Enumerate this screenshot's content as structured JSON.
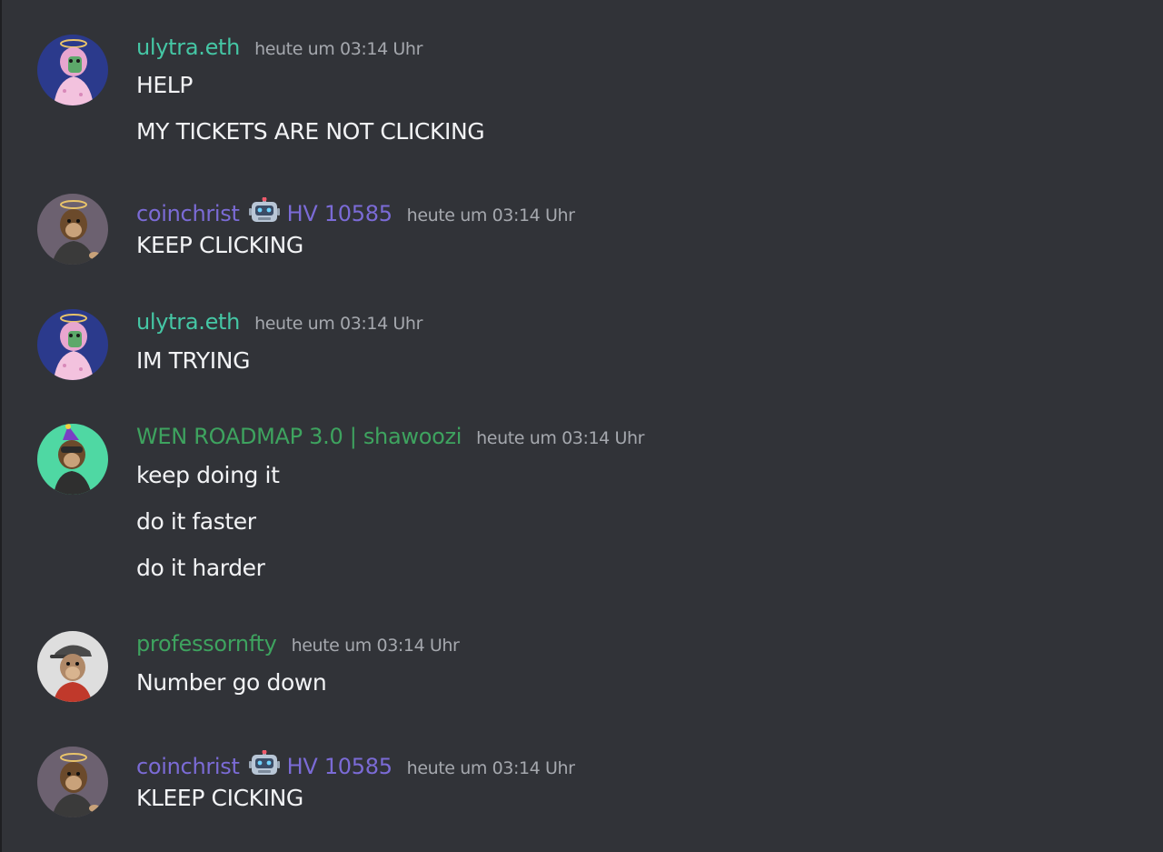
{
  "colors": {
    "background": "#313338",
    "timestamp": "#a5a8ae",
    "text": "#f2f3f5",
    "teal_name": "#45c7a5",
    "purple_name": "#7b6bd6",
    "green_name": "#3ea35f"
  },
  "messages": [
    {
      "author": "ulytra.eth",
      "author_color": "#45c7a5",
      "avatar_icon": "pink-ape-halo-avatar",
      "timestamp": "heute um 03:14 Uhr",
      "lines": [
        "HELP",
        "MY TICKETS ARE NOT CLICKING"
      ]
    },
    {
      "author": "coinchrist",
      "author_color": "#7b6bd6",
      "bot_icon": "robot-emoji-icon",
      "tag": "HV 10585",
      "avatar_icon": "brown-ape-halo-avatar",
      "timestamp": "heute um 03:14 Uhr",
      "lines": [
        "KEEP CLICKING"
      ]
    },
    {
      "author": "ulytra.eth",
      "author_color": "#45c7a5",
      "avatar_icon": "pink-ape-halo-avatar",
      "timestamp": "heute um 03:14 Uhr",
      "lines": [
        "IM TRYING"
      ]
    },
    {
      "author": "WEN ROADMAP 3.0 | shawoozi",
      "author_color": "#3ea35f",
      "avatar_icon": "party-hat-ape-avatar",
      "timestamp": "heute um 03:14 Uhr",
      "lines": [
        "keep doing it",
        "do it faster",
        "do it harder"
      ]
    },
    {
      "author": "professornfty",
      "author_color": "#3ea35f",
      "avatar_icon": "cap-ape-avatar",
      "timestamp": "heute um 03:14 Uhr",
      "lines": [
        "Number go down"
      ]
    },
    {
      "author": "coinchrist",
      "author_color": "#7b6bd6",
      "bot_icon": "robot-emoji-icon",
      "tag": "HV 10585",
      "avatar_icon": "brown-ape-halo-avatar",
      "timestamp": "heute um 03:14 Uhr",
      "lines": [
        "KLEEP CICKING"
      ]
    }
  ]
}
